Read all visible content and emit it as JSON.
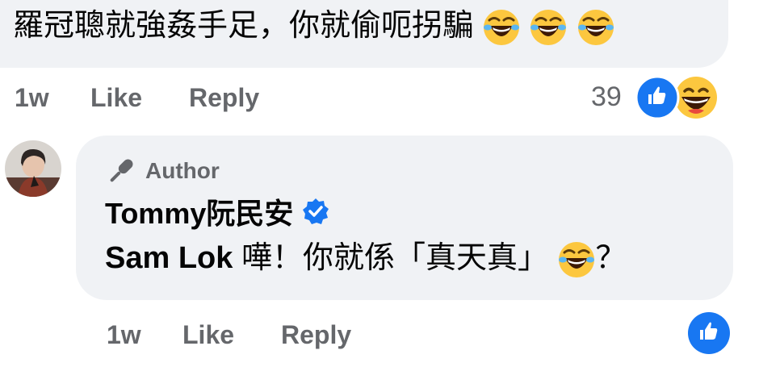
{
  "parent_comment": {
    "text": "羅冠聰就強姦手足，你就偷呃拐騙",
    "emojis": [
      "laughing-tears-emoji",
      "laughing-tears-emoji",
      "laughing-tears-emoji"
    ],
    "time": "1w",
    "like_label": "Like",
    "reply_label": "Reply",
    "reaction_count": "39",
    "reaction_icons": [
      "like-reaction-icon",
      "haha-reaction-icon"
    ]
  },
  "reply_comment": {
    "author_badge": "Author",
    "author_name": "Tommy阮民安",
    "verified": true,
    "mention": "Sam Lok",
    "text_before_emoji": " 嘩！你就係「真天真」",
    "emoji": "laughing-tears-emoji",
    "text_after_emoji": "？",
    "time": "1w",
    "like_label": "Like",
    "reply_label": "Reply",
    "reaction_icons": [
      "like-reaction-icon"
    ]
  },
  "colors": {
    "bubble": "#f0f2f5",
    "meta_text": "#65676b",
    "like_blue": "#1877f2",
    "haha_yellow": "#fcc73f"
  }
}
